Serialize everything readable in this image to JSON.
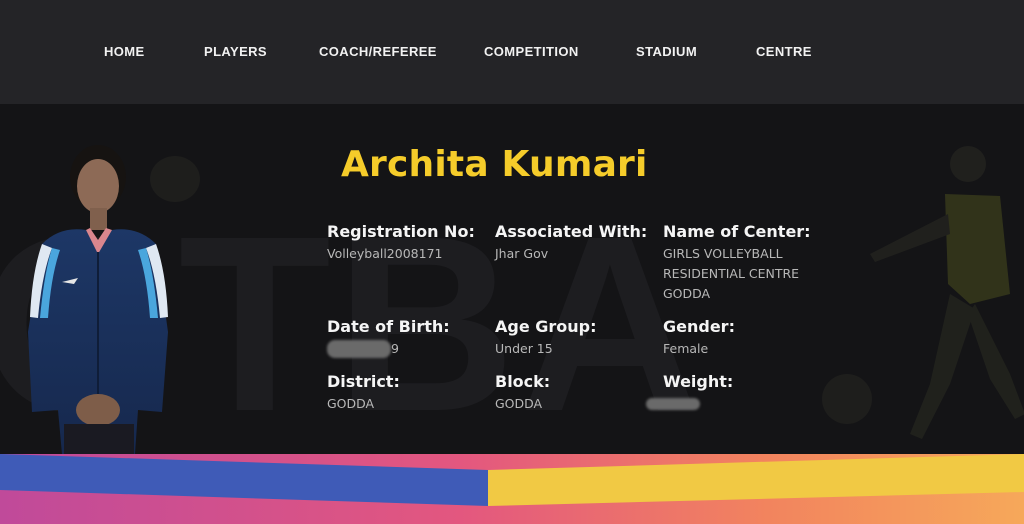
{
  "nav": {
    "items": [
      {
        "label": "HOME"
      },
      {
        "label": "PLAYERS"
      },
      {
        "label": "COACH/REFEREE"
      },
      {
        "label": "COMPETITION"
      },
      {
        "label": "STADIUM"
      },
      {
        "label": "CENTRE"
      }
    ]
  },
  "player": {
    "name": "Archita Kumari",
    "fields": {
      "registration": {
        "label": "Registration No:",
        "value": "Volleyball2008171"
      },
      "associated": {
        "label": "Associated With:",
        "value": "Jhar Gov"
      },
      "center": {
        "label": "Name of Center:",
        "value": "GIRLS VOLLEYBALL RESIDENTIAL CENTRE GODDA"
      },
      "dob": {
        "label": "Date of Birth:",
        "value": "9"
      },
      "age_group": {
        "label": "Age Group:",
        "value": "Under 15"
      },
      "gender": {
        "label": "Gender:",
        "value": "Female"
      },
      "district": {
        "label": "District:",
        "value": "GODDA"
      },
      "block": {
        "label": "Block:",
        "value": "GODDA"
      },
      "weight": {
        "label": "Weight:",
        "value": ""
      }
    }
  },
  "colors": {
    "name_accent": "#f5cc2a",
    "nav_bg": "#242427",
    "stripe_blue": "#3d5bb5",
    "stripe_yellow": "#f1c944",
    "stripe_pink": "#d2518c"
  }
}
